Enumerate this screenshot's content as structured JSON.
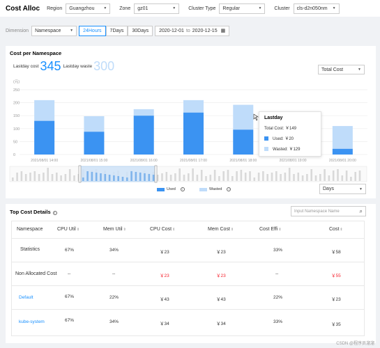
{
  "header": {
    "title": "Cost Alloc",
    "region_label": "Region",
    "region_value": "Guangzhou",
    "zone_label": "Zone",
    "zone_value": "gz01",
    "cluster_type_label": "Cluster Type",
    "cluster_type_value": "Regular",
    "cluster_label": "Cluster",
    "cluster_value": "cls-d2n050nm"
  },
  "filter": {
    "dimension_label": "Dimension",
    "dimension_value": "Namespace",
    "ranges": [
      "24Hours",
      "7Days",
      "30Days"
    ],
    "active_range": "24Hours",
    "date_start": "2020-12-01",
    "date_to": "to",
    "date_end": "2020-12-15"
  },
  "cost_panel": {
    "title": "Cost per Namespace",
    "lastday_cost_label": "Lastday cost",
    "lastday_cost_value": "345",
    "lastday_waste_label": "Lastday waste",
    "lastday_waste_value": "300",
    "metric_select": "Total Cost",
    "interval_select": "Days",
    "legend": {
      "used": "Used",
      "wasted": "Wasted"
    },
    "tooltip": {
      "title": "Lastday",
      "total": "Total Cost: ￥149",
      "used": "Used: ￥20",
      "wasted": "Wasted: ￥129"
    }
  },
  "chart_data": {
    "type": "bar",
    "stacked": true,
    "yunit": "(元)",
    "ylim": [
      0,
      250
    ],
    "yticks": [
      0,
      50,
      100,
      150,
      200,
      250
    ],
    "xticks": [
      "2021/08/01 14:00",
      "2021/08/01 15:00",
      "2021/08/01 16:00",
      "2021/08/01 17:00",
      "2021/08/01 18:00",
      "2021/08/01 19:00",
      "2021/08/01 20:00"
    ],
    "bar_positions": [
      0,
      1,
      2,
      3,
      4,
      6
    ],
    "series": [
      {
        "name": "Used",
        "values": [
          130,
          88,
          150,
          162,
          96,
          22
        ]
      },
      {
        "name": "Wasted",
        "values": [
          80,
          60,
          25,
          48,
          96,
          88
        ]
      }
    ],
    "colors": {
      "used": "#3b93f2",
      "wasted": "#bfdcfa"
    },
    "grid": true,
    "legend_position": "bottom"
  },
  "details": {
    "title": "Top Cost Details",
    "search_placeholder": "Input Namespace Name",
    "columns": [
      "Namespace",
      "CPU Util",
      "Mem Util",
      "CPU Cost",
      "Mem Cost",
      "Cost Effi",
      "Cost"
    ],
    "rows": [
      {
        "ns": "Statistics",
        "cpu_util": "67%",
        "mem_util": "34%",
        "cpu_cost": "￥23",
        "mem_cost": "￥23",
        "cost_effi": "33%",
        "cost": "￥58"
      },
      {
        "ns": "Non Allocated Cost",
        "cpu_util": "--",
        "mem_util": "--",
        "cpu_cost": "￥23",
        "mem_cost": "￥23",
        "cost_effi": "--",
        "cost": "￥55"
      },
      {
        "ns": "Default",
        "cpu_util": "67%",
        "mem_util": "22%",
        "cpu_cost": "￥43",
        "mem_cost": "￥43",
        "cost_effi": "22%",
        "cost": "￥23"
      },
      {
        "ns": "kube-system",
        "cpu_util": "67%",
        "mem_util": "34%",
        "cpu_cost": "￥34",
        "mem_cost": "￥34",
        "cost_effi": "33%",
        "cost": "￥35"
      }
    ]
  },
  "watermark": "CSDN @程序员溜溜"
}
